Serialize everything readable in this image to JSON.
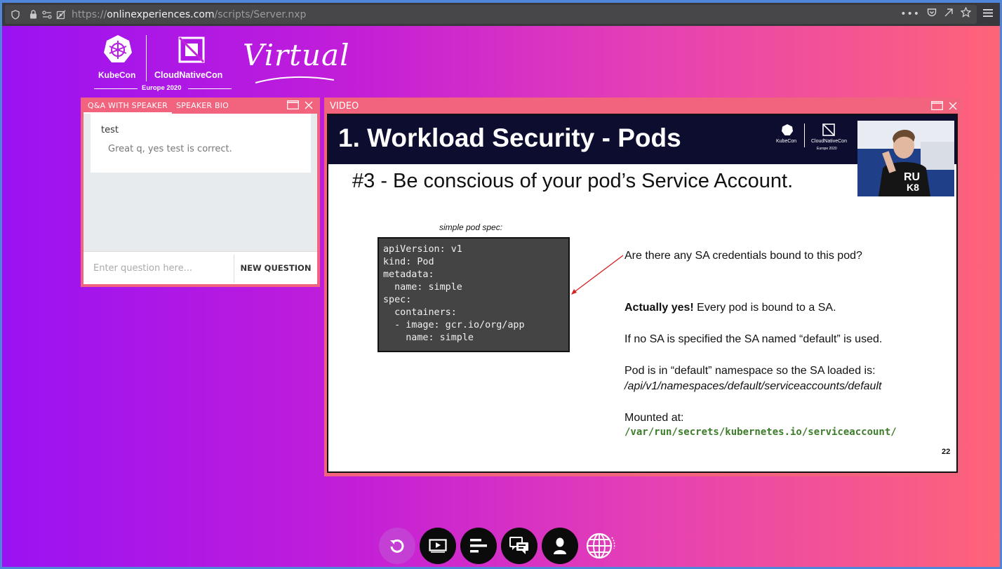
{
  "browser": {
    "url_prefix": "https://",
    "url_domain": "onlinexperiences.com",
    "url_path": "/scripts/Server.nxp"
  },
  "branding": {
    "kubecon": "KubeCon",
    "cloudnativecon": "CloudNativeCon",
    "edition": "Europe 2020",
    "virtual": "Virtual"
  },
  "qa_panel": {
    "tabs": [
      "Q&A WITH SPEAKER",
      "SPEAKER BIO"
    ],
    "question": "test",
    "answer": "Great q, yes test is correct.",
    "input_placeholder": "Enter question here...",
    "submit_label": "NEW QUESTION"
  },
  "video_panel": {
    "title": "VIDEO",
    "slide": {
      "title": "1. Workload Security - Pods",
      "subtitle": "#3 - Be conscious of your pod’s Service Account.",
      "spec_label": "simple pod spec:",
      "spec_lines": [
        "apiVersion: v1",
        "kind: Pod",
        "metadata:",
        "  name: simple",
        "spec:",
        "  containers:",
        "  - image: gcr.io/org/app",
        "    name: simple"
      ],
      "question": "Are there any SA credentials bound to this pod?",
      "answer_bold": "Actually yes!",
      "answer_rest": " Every pod is bound to a SA.",
      "default_note": "If no SA is specified the SA named “default” is used.",
      "namespace_note": "Pod is in “default” namespace so the SA loaded is:",
      "sa_path": "/api/v1/namespaces/default/serviceaccounts/default",
      "mounted_label": "Mounted at:",
      "mount_path": "/var/run/secrets/kubernetes.io/serviceaccount/",
      "page_number": "22",
      "logo_kubecon": "KubeCon",
      "logo_cnc": "CloudNativeCon",
      "logo_europe": "Europe 2020",
      "shirt_text_1": "RU",
      "shirt_text_2": "K8"
    }
  },
  "dock": {
    "buttons": [
      "refresh-icon",
      "video-icon",
      "agenda-icon",
      "chat-icon",
      "profile-icon",
      "language-icon"
    ]
  },
  "colors": {
    "panel_accent": "#f2637d",
    "gradient_start": "#9a12f2",
    "gradient_end": "#ff6478",
    "code_green": "#3c7d2a"
  }
}
